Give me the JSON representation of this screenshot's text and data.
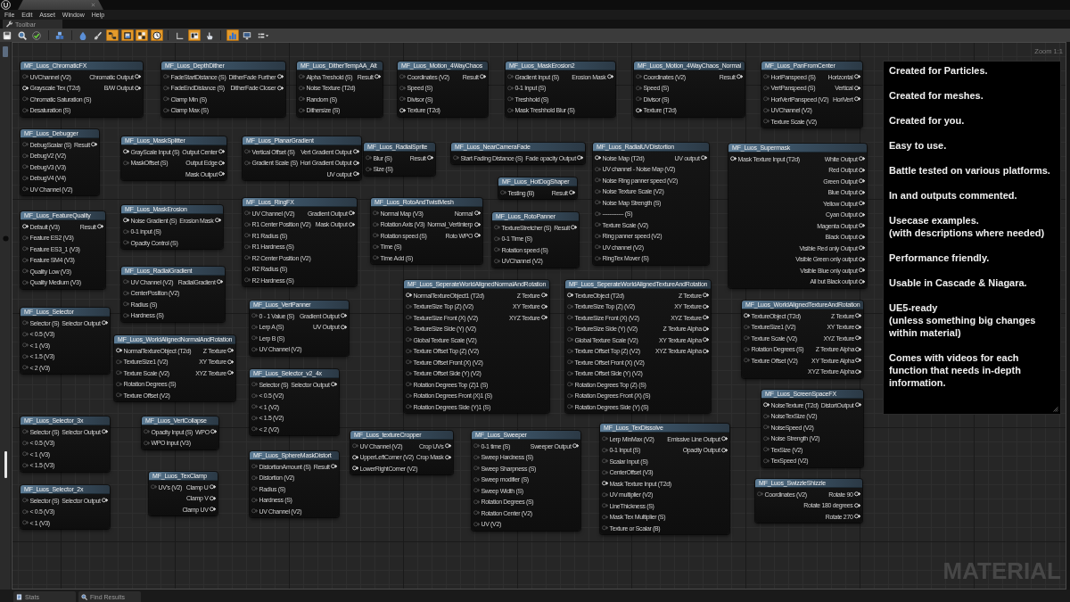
{
  "window": {
    "menu": [
      "File",
      "Edit",
      "Asset",
      "Window",
      "Help"
    ],
    "toolbar_tab": "Toolbar"
  },
  "toolbar": [
    {
      "kind": "floppy",
      "active": false
    },
    {
      "kind": "magnifier",
      "active": false
    },
    {
      "kind": "check",
      "active": false
    },
    {
      "kind": "cubes",
      "active": false
    },
    {
      "kind": "droplet",
      "active": false
    },
    {
      "kind": "brush",
      "active": false
    },
    {
      "kind": "node-graph",
      "active": true
    },
    {
      "kind": "frame",
      "active": true
    },
    {
      "kind": "tiles",
      "active": true
    },
    {
      "kind": "clock",
      "active": true
    },
    {
      "kind": "corner",
      "active": false
    },
    {
      "kind": "split",
      "active": true
    },
    {
      "kind": "hand",
      "active": false
    },
    {
      "kind": "bars",
      "active": true
    },
    {
      "kind": "monitor",
      "active": false
    },
    {
      "kind": "list-dropdown",
      "active": false
    }
  ],
  "graph": {
    "zoom": "Zoom 1:1",
    "type_label": "MATERIAL",
    "nodes": [
      {
        "title": "MF_Luos_ChromaticFX",
        "inputs": [
          {
            "label": "UVChannel (V2)",
            "required": false
          },
          {
            "label": "Grayscale Tex (T2d)",
            "required": true
          },
          {
            "label": "Chromatic Saturation (S)",
            "required": false
          },
          {
            "label": "Desaturation (S)",
            "required": false
          }
        ],
        "outputs": [
          "Chromatic Output",
          "B/W Output"
        ]
      },
      {
        "title": "MF_Luos_DepthDither",
        "inputs": [
          {
            "label": "FadeStartDistance (S)",
            "required": false
          },
          {
            "label": "FadeEndDistance (S)",
            "required": false
          },
          {
            "label": "Clamp Min (S)",
            "required": false
          },
          {
            "label": "Clamp Max (S)",
            "required": false
          }
        ],
        "outputs": [
          "DitherFade Further",
          "DitherFade Closer"
        ]
      },
      {
        "title": "MF_Luos_DitherTempAA_Alt",
        "inputs": [
          {
            "label": "Alpha Treshold (S)",
            "required": false
          },
          {
            "label": "Noise Texture (T2d)",
            "required": false
          },
          {
            "label": "Random (S)",
            "required": false
          },
          {
            "label": "Dithersize (S)",
            "required": false
          }
        ],
        "outputs": [
          "Result"
        ]
      },
      {
        "title": "MF_Luos_Motion_4WayChaos",
        "inputs": [
          {
            "label": "Coordinates (V2)",
            "required": false
          },
          {
            "label": "Speed (S)",
            "required": false
          },
          {
            "label": "Divisor (S)",
            "required": false
          },
          {
            "label": "Texture (T2d)",
            "required": true
          }
        ],
        "outputs": [
          "Result"
        ]
      },
      {
        "title": "MF_Luos_MaskErosion2",
        "inputs": [
          {
            "label": "Gradient Input (S)",
            "required": false
          },
          {
            "label": "0-1 Input (S)",
            "required": false
          },
          {
            "label": "Treshhold (S)",
            "required": false
          },
          {
            "label": "Mask Treshhold Blur (S)",
            "required": false
          }
        ],
        "outputs": [
          "Erosion Mask"
        ]
      },
      {
        "title": "MF_Luos_Motion_4WayChaos_Normal",
        "inputs": [
          {
            "label": "Coordinates (V2)",
            "required": false
          },
          {
            "label": "Speed (S)",
            "required": false
          },
          {
            "label": "Divisor (S)",
            "required": false
          },
          {
            "label": "Texture (T2d)",
            "required": true
          }
        ],
        "outputs": [
          "Result"
        ]
      },
      {
        "title": "MF_Luos_PanFromCenter",
        "inputs": [
          {
            "label": "HoriPanspeed (S)",
            "required": false
          },
          {
            "label": "VertPanspeed (S)",
            "required": false
          },
          {
            "label": "HoriVertPanspeed (V2)",
            "required": false
          },
          {
            "label": "UVChannel (V2)",
            "required": false
          },
          {
            "label": "Texture Scale (V2)",
            "required": false
          }
        ],
        "outputs": [
          "Horizontal",
          "Vertical",
          "HoriVert"
        ]
      },
      {
        "title": "MF_Luos_Debugger",
        "inputs": [
          {
            "label": "DebugScalar (S)",
            "required": false
          },
          {
            "label": "DebugV2 (V2)",
            "required": false
          },
          {
            "label": "DebugV3 (V3)",
            "required": false
          },
          {
            "label": "DebugV4 (V4)",
            "required": false
          },
          {
            "label": "UV Channel (V2)",
            "required": false
          }
        ],
        "outputs": [
          "Result"
        ]
      },
      {
        "title": "MF_Luos_MaskSplitter",
        "inputs": [
          {
            "label": "GrayScale Input (S)",
            "required": true
          },
          {
            "label": "MaskOffset (S)",
            "required": false
          }
        ],
        "outputs": [
          "Output Center",
          "Output Edge",
          "Mask Output"
        ]
      },
      {
        "title": "MF_Luos_PlanarGradient",
        "inputs": [
          {
            "label": "Vertical Offset (S)",
            "required": false
          },
          {
            "label": "Gradient Scale (S)",
            "required": false
          }
        ],
        "outputs": [
          "Vert Gradient Output",
          "Hori Gradient Output",
          "UV output"
        ]
      },
      {
        "title": "MF_Luos_RadialSprite",
        "inputs": [
          {
            "label": "Blur (S)",
            "required": false
          },
          {
            "label": "Size (S)",
            "required": false
          }
        ],
        "outputs": [
          "Result"
        ]
      },
      {
        "title": "MF_Luos_NearCameraFade",
        "inputs": [
          {
            "label": "Start Fading Distance (S)",
            "required": false
          }
        ],
        "outputs": [
          "Fade opacity Output"
        ]
      },
      {
        "title": "MF_Luos_HotDogShaper",
        "inputs": [
          {
            "label": "Testing (B)",
            "required": false
          }
        ],
        "outputs": [
          "Result"
        ]
      },
      {
        "title": "MF_Luos_FeatureQuality",
        "inputs": [
          {
            "label": "Default (V3)",
            "required": true
          },
          {
            "label": "Feature ES2 (V3)",
            "required": false
          },
          {
            "label": "Feature ES3_1 (V3)",
            "required": false
          },
          {
            "label": "Feature SM4 (V3)",
            "required": false
          },
          {
            "label": "Quality Low (V3)",
            "required": false
          },
          {
            "label": "Quality Medium (V3)",
            "required": false
          }
        ],
        "outputs": [
          "Result"
        ]
      },
      {
        "title": "MF_Luos_MaskErosion",
        "inputs": [
          {
            "label": "Noise Gradient (S)",
            "required": true
          },
          {
            "label": "0-1 input (S)",
            "required": false
          },
          {
            "label": "Opacity Control (S)",
            "required": false
          }
        ],
        "outputs": [
          "Erosion Mask"
        ]
      },
      {
        "title": "MF_Luos_RingFX",
        "inputs": [
          {
            "label": "UV Channel (V2)",
            "required": false
          },
          {
            "label": "R1 Center Position (V2)",
            "required": false
          },
          {
            "label": "R1 Radius (S)",
            "required": false
          },
          {
            "label": "R1 Hardness (S)",
            "required": false
          },
          {
            "label": "R2 Center Position (V2)",
            "required": false
          },
          {
            "label": "R2 Radius (S)",
            "required": false
          },
          {
            "label": "R2 Hardness (S)",
            "required": false
          }
        ],
        "outputs": [
          "Gradient Output",
          "Mask Output"
        ]
      },
      {
        "title": "MF_Luos_RotoAndTwistMesh",
        "inputs": [
          {
            "label": "Normal Map (V3)",
            "required": false
          },
          {
            "label": "Rotation Axis (V3)",
            "required": false
          },
          {
            "label": "Rotation speed (S)",
            "required": false
          },
          {
            "label": "Time (S)",
            "required": false
          },
          {
            "label": "Time Add (S)",
            "required": false
          }
        ],
        "outputs": [
          "Normal",
          "Normal_VertInterp",
          "Roto WPO"
        ]
      },
      {
        "title": "MF_Luos_RotoPanner",
        "inputs": [
          {
            "label": "TextureStretcher (S)",
            "required": false
          },
          {
            "label": "0-1 Time (S)",
            "required": false
          },
          {
            "label": "Rotation speed (S)",
            "required": false
          },
          {
            "label": "UVChannel (V2)",
            "required": false
          }
        ],
        "outputs": [
          "Result"
        ]
      },
      {
        "title": "MF_Luos_RadialUVDistortion",
        "inputs": [
          {
            "label": "Noise Map (T2d)",
            "required": true
          },
          {
            "label": "UV channel - Noise Map (V2)",
            "required": false
          },
          {
            "label": "Noise Ring panner speed (V2)",
            "required": false
          },
          {
            "label": "Noise Texture Scale (V2)",
            "required": false
          },
          {
            "label": "Noise Map Strength (S)",
            "required": false
          },
          {
            "label": "------------ (S)",
            "required": false
          },
          {
            "label": "Texture Scale (V2)",
            "required": false
          },
          {
            "label": "Ring panner speed (V2)",
            "required": false
          },
          {
            "label": "UV channel (V2)",
            "required": false
          },
          {
            "label": "RingTex Mover (S)",
            "required": false
          }
        ],
        "outputs": [
          "UV output"
        ]
      },
      {
        "title": "MF_Luos_Supermask",
        "inputs": [
          {
            "label": "Mask Texture Input (T2d)",
            "required": true
          }
        ],
        "outputs": [
          "White Output",
          "Red Output",
          "Green Output",
          "Blue Output",
          "Yellow Output",
          "Cyan Output",
          "Magenta Output",
          "Black Output",
          "Visible Red only Output",
          "Visible Green only output",
          "Visible Blue only output",
          "All but Black output"
        ]
      },
      {
        "title": "MF_Luos_RadialGradient",
        "inputs": [
          {
            "label": "UV Channel (V2)",
            "required": false
          },
          {
            "label": "CenterPosition (V2)",
            "required": false
          },
          {
            "label": "Radius (S)",
            "required": false
          },
          {
            "label": "Hardness (S)",
            "required": false
          }
        ],
        "outputs": [
          "RadialGradient"
        ]
      },
      {
        "title": "MF_Luos_Selector",
        "inputs": [
          {
            "label": "Selector (S)",
            "required": false
          },
          {
            "label": "< 0.5 (V3)",
            "required": false
          },
          {
            "label": "< 1 (V3)",
            "required": false
          },
          {
            "label": "< 1.5 (V3)",
            "required": false
          },
          {
            "label": "< 2 (V3)",
            "required": false
          }
        ],
        "outputs": [
          "Selector Output"
        ]
      },
      {
        "title": "MF_Luos_VertPanner",
        "inputs": [
          {
            "label": "0 - 1 Value (S)",
            "required": false
          },
          {
            "label": "Lerp A (S)",
            "required": false
          },
          {
            "label": "Lerp B (S)",
            "required": false
          },
          {
            "label": "UV Channel (V2)",
            "required": false
          }
        ],
        "outputs": [
          "Gradient Output",
          "UV Output"
        ]
      },
      {
        "title": "MF_Luos_WorldAlignedNormalAndRotation",
        "inputs": [
          {
            "label": "NormalTextureObject (T2d)",
            "required": true
          },
          {
            "label": "TextureSize1 (V2)",
            "required": false
          },
          {
            "label": "Texture Scale (V2)",
            "required": false
          },
          {
            "label": "Rotation Degrees (S)",
            "required": false
          },
          {
            "label": "Texture Offset (V2)",
            "required": false
          }
        ],
        "outputs": [
          "Z Texture",
          "XY Texture",
          "XYZ Texture"
        ]
      },
      {
        "title": "MF_Luos_Selector_3x",
        "inputs": [
          {
            "label": "Selector (S)",
            "required": false
          },
          {
            "label": "< 0.5 (V3)",
            "required": false
          },
          {
            "label": "< 1 (V3)",
            "required": false
          },
          {
            "label": "< 1.5 (V3)",
            "required": false
          }
        ],
        "outputs": [
          "Selector Output"
        ]
      },
      {
        "title": "MF_Luos_VertCollapse",
        "inputs": [
          {
            "label": "Opacity Input (S)",
            "required": false
          },
          {
            "label": "WPO input (V3)",
            "required": false
          }
        ],
        "outputs": [
          "WPO"
        ]
      },
      {
        "title": "MF_Luos_Selector_v2_4x",
        "inputs": [
          {
            "label": "Selector (S)",
            "required": false
          },
          {
            "label": "< 0.5 (V2)",
            "required": false
          },
          {
            "label": "< 1 (V2)",
            "required": false
          },
          {
            "label": "< 1.5 (V2)",
            "required": false
          },
          {
            "label": "< 2 (V2)",
            "required": false
          }
        ],
        "outputs": [
          "Selector Output"
        ]
      },
      {
        "title": "MF_Luos_SeperateWorldAlignedNormalAndRotation",
        "inputs": [
          {
            "label": "NormalTextureObject1 (T2d)",
            "required": true
          },
          {
            "label": "TextureSize Top (Z) (V2)",
            "required": false
          },
          {
            "label": "TextureSize Front (X) (V2)",
            "required": false
          },
          {
            "label": "TextureSize Side (Y) (V2)",
            "required": false
          },
          {
            "label": "Global Texture Scale (V2)",
            "required": false
          },
          {
            "label": "Texture Offset Top (Z) (V2)",
            "required": false
          },
          {
            "label": "Texture Offset Front (X) (V2)",
            "required": false
          },
          {
            "label": "Texture Offset Side (Y) (V2)",
            "required": false
          },
          {
            "label": "Rotation Degrees Top (Z)1 (S)",
            "required": false
          },
          {
            "label": "Rotation Degrees Front (X)1 (S)",
            "required": false
          },
          {
            "label": "Rotation Degrees Side (Y)1 (S)",
            "required": false
          }
        ],
        "outputs": [
          "Z Texture",
          "XY Texture",
          "XYZ Texture"
        ]
      },
      {
        "title": "MF_Luos_SeperateWorldAlignedTextureAndRotation",
        "inputs": [
          {
            "label": "TextureObject (T2d)",
            "required": true
          },
          {
            "label": "TextureSize Top (Z) (V2)",
            "required": false
          },
          {
            "label": "TextureSize Front (X) (V2)",
            "required": false
          },
          {
            "label": "TextureSize Side (Y) (V2)",
            "required": false
          },
          {
            "label": "Global Texture Scale (V2)",
            "required": false
          },
          {
            "label": "Texture Offset Top (Z) (V2)",
            "required": false
          },
          {
            "label": "Texture Offset Front (X) (V2)",
            "required": false
          },
          {
            "label": "Texture Offset Side (Y) (V2)",
            "required": false
          },
          {
            "label": "Rotation Degrees Top (Z) (S)",
            "required": false
          },
          {
            "label": "Rotation Degrees Front (X) (S)",
            "required": false
          },
          {
            "label": "Rotation Degrees Side (Y) (S)",
            "required": false
          }
        ],
        "outputs": [
          "Z Texture",
          "XY Texture",
          "XYZ Texture",
          "Z Texture Alpha",
          "XY Texture Alpha",
          "XYZ Texture Alpha"
        ]
      },
      {
        "title": "MF_Luos_WorldAlignedTextureAndRotation",
        "inputs": [
          {
            "label": "TextureObject (T2d)",
            "required": true
          },
          {
            "label": "TextureSize1 (V2)",
            "required": false
          },
          {
            "label": "Texture Scale (V2)",
            "required": false
          },
          {
            "label": "Rotation Degrees (S)",
            "required": false
          },
          {
            "label": "Texture Offset (V2)",
            "required": false
          }
        ],
        "outputs": [
          "Z Texture",
          "XY Texture",
          "XYZ Texture",
          "Z Texture Alpha",
          "XY Texture Alpha",
          "XYZ Texture Alpha"
        ]
      },
      {
        "title": "MF_Luos_Selector_2x",
        "inputs": [
          {
            "label": "Selector (S)",
            "required": false
          },
          {
            "label": "< 0.5 (V3)",
            "required": false
          },
          {
            "label": "< 1 (V3)",
            "required": false
          }
        ],
        "outputs": [
          "Selector Output"
        ]
      },
      {
        "title": "MF_Luos_TexClamp",
        "inputs": [
          {
            "label": "UV's (V2)",
            "required": false
          }
        ],
        "outputs": [
          "Clamp U",
          "Clamp V",
          "Clamp UV"
        ]
      },
      {
        "title": "MF_Luos_SphereMaskDistort",
        "inputs": [
          {
            "label": "DistortionAmount (S)",
            "required": false
          },
          {
            "label": "Distortion (V2)",
            "required": false
          },
          {
            "label": "Radius (S)",
            "required": false
          },
          {
            "label": "Hardness (S)",
            "required": false
          },
          {
            "label": "UV Channel (V2)",
            "required": false
          }
        ],
        "outputs": [
          "Result"
        ]
      },
      {
        "title": "MF_Luos_textureCropper",
        "inputs": [
          {
            "label": "UV Channel (V2)",
            "required": false
          },
          {
            "label": "UpperLeftCorner (V2)",
            "required": true
          },
          {
            "label": "LowerRightCorner (V2)",
            "required": true
          }
        ],
        "outputs": [
          "Crop UVs",
          "Crop Mask"
        ]
      },
      {
        "title": "MF_Luos_Sweeper",
        "inputs": [
          {
            "label": "0-1 time (S)",
            "required": false
          },
          {
            "label": "Sweep Hardness (S)",
            "required": false
          },
          {
            "label": "Sweep Sharpness (S)",
            "required": false
          },
          {
            "label": "Sweep modifier (S)",
            "required": false
          },
          {
            "label": "Sweep Width (S)",
            "required": false
          },
          {
            "label": "Rotation Degrees (S)",
            "required": false
          },
          {
            "label": "Rotation Center (V2)",
            "required": false
          },
          {
            "label": "UV (V2)",
            "required": false
          }
        ],
        "outputs": [
          "Sweeper Output"
        ]
      },
      {
        "title": "MF_Luos_TexDissolve",
        "inputs": [
          {
            "label": "Lerp MinMax (V2)",
            "required": false
          },
          {
            "label": "0-1 Input (S)",
            "required": false
          },
          {
            "label": "Scalar Input (S)",
            "required": false
          },
          {
            "label": "CenterOffset (V3)",
            "required": false
          },
          {
            "label": "Mask Texture Input (T2d)",
            "required": true
          },
          {
            "label": "UV multiplier (V2)",
            "required": false
          },
          {
            "label": "LineThickness (S)",
            "required": false
          },
          {
            "label": "Mask Tex Multiplier (S)",
            "required": false
          },
          {
            "label": "Texture or Scalar (B)",
            "required": false
          }
        ],
        "outputs": [
          "Emissive Line Output",
          "Opacity Output"
        ]
      },
      {
        "title": "MF_Luos_ScreenSpaceFX",
        "inputs": [
          {
            "label": "NoiseTexture (T2d)",
            "required": true
          },
          {
            "label": "NoiseTexSize (V2)",
            "required": false
          },
          {
            "label": "NoiseSpeed (V2)",
            "required": false
          },
          {
            "label": "Noise Strength (V2)",
            "required": false
          },
          {
            "label": "TexSize (V2)",
            "required": false
          },
          {
            "label": "TexSpeed (V2)",
            "required": false
          }
        ],
        "outputs": [
          "DistortOutput"
        ]
      },
      {
        "title": "MF_Luos_SwizzleShizzle",
        "inputs": [
          {
            "label": "Coordinates (V2)",
            "required": false
          }
        ],
        "outputs": [
          "Rotate 90",
          "Rotate 180 degrees",
          "Rotate 270"
        ]
      }
    ],
    "comment": {
      "paragraphs": [
        [
          "Created for Particles."
        ],
        [
          "Created for meshes."
        ],
        [
          "Created for you."
        ],
        [
          "Easy to use."
        ],
        [
          "Battle tested on various platforms."
        ],
        [
          "In and outputs commented."
        ],
        [
          "Usecase examples.",
          "(with descriptions where needed)"
        ],
        [
          "Performance friendly."
        ],
        [
          "Usable in Cascade & Niagara."
        ],
        [
          "UE5-ready",
          "(unless something big changes",
          "within material)"
        ],
        [
          "Comes with videos for each",
          "function that needs in-depth",
          "information."
        ]
      ]
    }
  },
  "bottom_tabs": [
    {
      "label": "Stats",
      "kind": "stats"
    },
    {
      "label": "Find Results",
      "kind": "find"
    }
  ]
}
